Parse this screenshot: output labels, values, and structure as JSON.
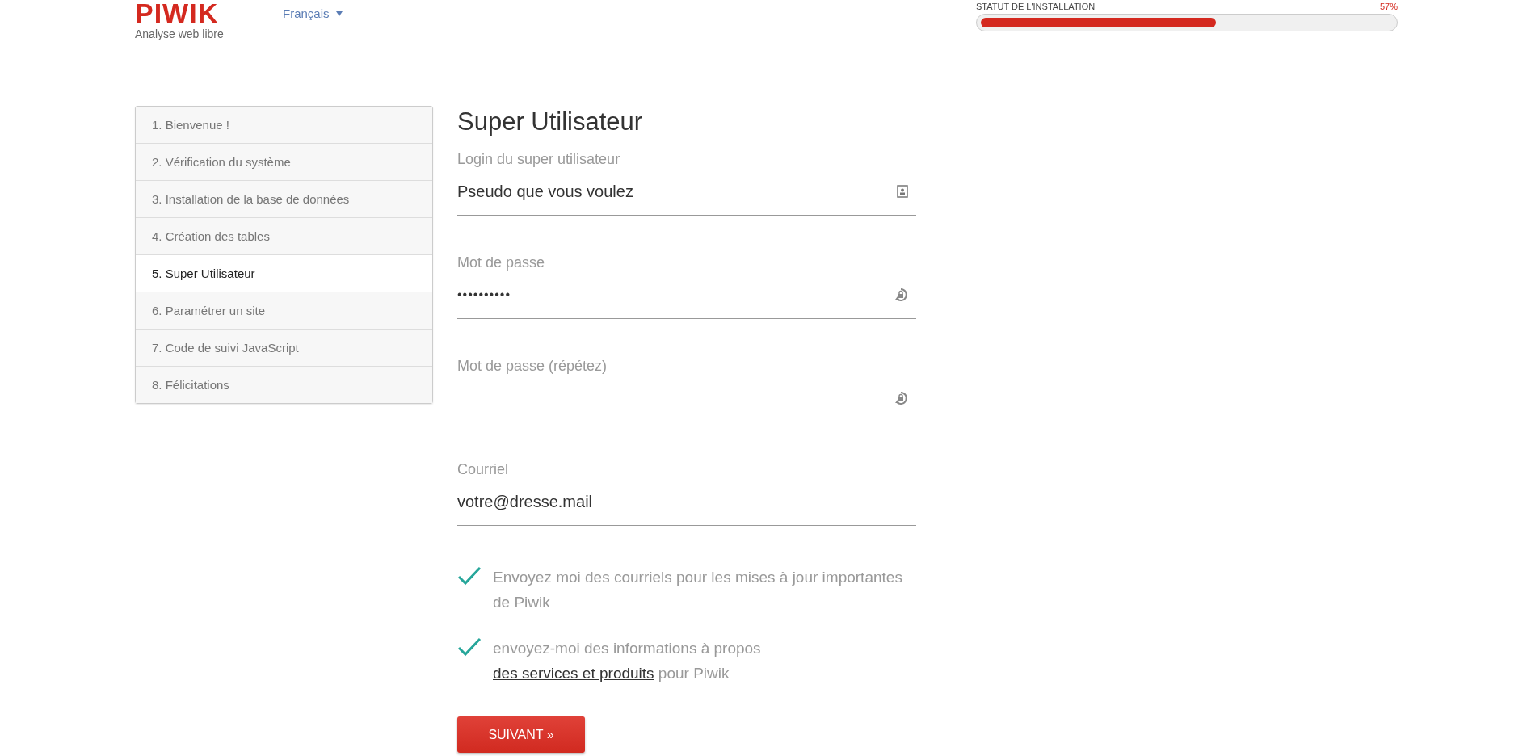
{
  "header": {
    "logo": "PIWIK",
    "tagline": "Analyse web libre",
    "language": "Français",
    "status_label": "STATUT DE L'INSTALLATION",
    "status_percent": "57%",
    "progress": {
      "level": 0.57
    }
  },
  "steps": [
    {
      "label": "1. Bienvenue !",
      "selected": false
    },
    {
      "label": "2. Vérification du système",
      "selected": false
    },
    {
      "label": "3. Installation de la base de données",
      "selected": false
    },
    {
      "label": "4. Création des tables",
      "selected": false
    },
    {
      "label": "5. Super Utilisateur",
      "selected": true
    },
    {
      "label": "6. Paramétrer un site",
      "selected": false
    },
    {
      "label": "7. Code de suivi JavaScript",
      "selected": false
    },
    {
      "label": "8. Félicitations",
      "selected": false
    }
  ],
  "form": {
    "title": "Super Utilisateur",
    "fields": [
      {
        "label": "Login du super utilisateur",
        "value": "Pseudo que vous voulez",
        "kind": "login"
      },
      {
        "label": "Mot de passe",
        "value": "••••••••••",
        "kind": "password"
      },
      {
        "label": "Mot de passe (répétez)",
        "kind": "password"
      },
      {
        "label": "Courriel",
        "value": "votre@dresse.mail",
        "kind": "email"
      }
    ],
    "checkboxes": [
      {
        "text": "Envoyez moi des courriels pour les mises à jour importantes de Piwik",
        "checked": true
      },
      {
        "text": "envoyez-moi des informations à propos",
        "link": "des services et produits",
        "after": "pour Piwik",
        "checked": true
      }
    ],
    "submit": "SUIVANT »"
  }
}
